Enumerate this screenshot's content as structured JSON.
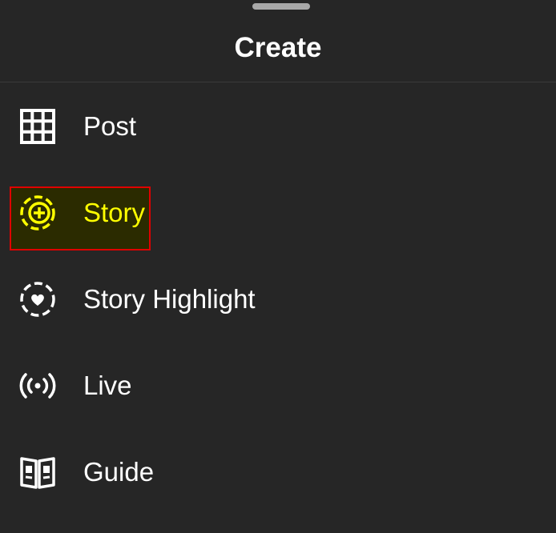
{
  "header": {
    "title": "Create"
  },
  "menu": {
    "items": [
      {
        "label": "Post",
        "icon": "grid-icon"
      },
      {
        "label": "Story",
        "icon": "story-add-icon"
      },
      {
        "label": "Story Highlight",
        "icon": "story-highlight-icon"
      },
      {
        "label": "Live",
        "icon": "live-broadcast-icon"
      },
      {
        "label": "Guide",
        "icon": "guide-book-icon"
      }
    ]
  },
  "colors": {
    "background": "#262626",
    "text": "#ffffff",
    "highlight_text": "#ffff00",
    "highlight_border": "#e00000"
  }
}
